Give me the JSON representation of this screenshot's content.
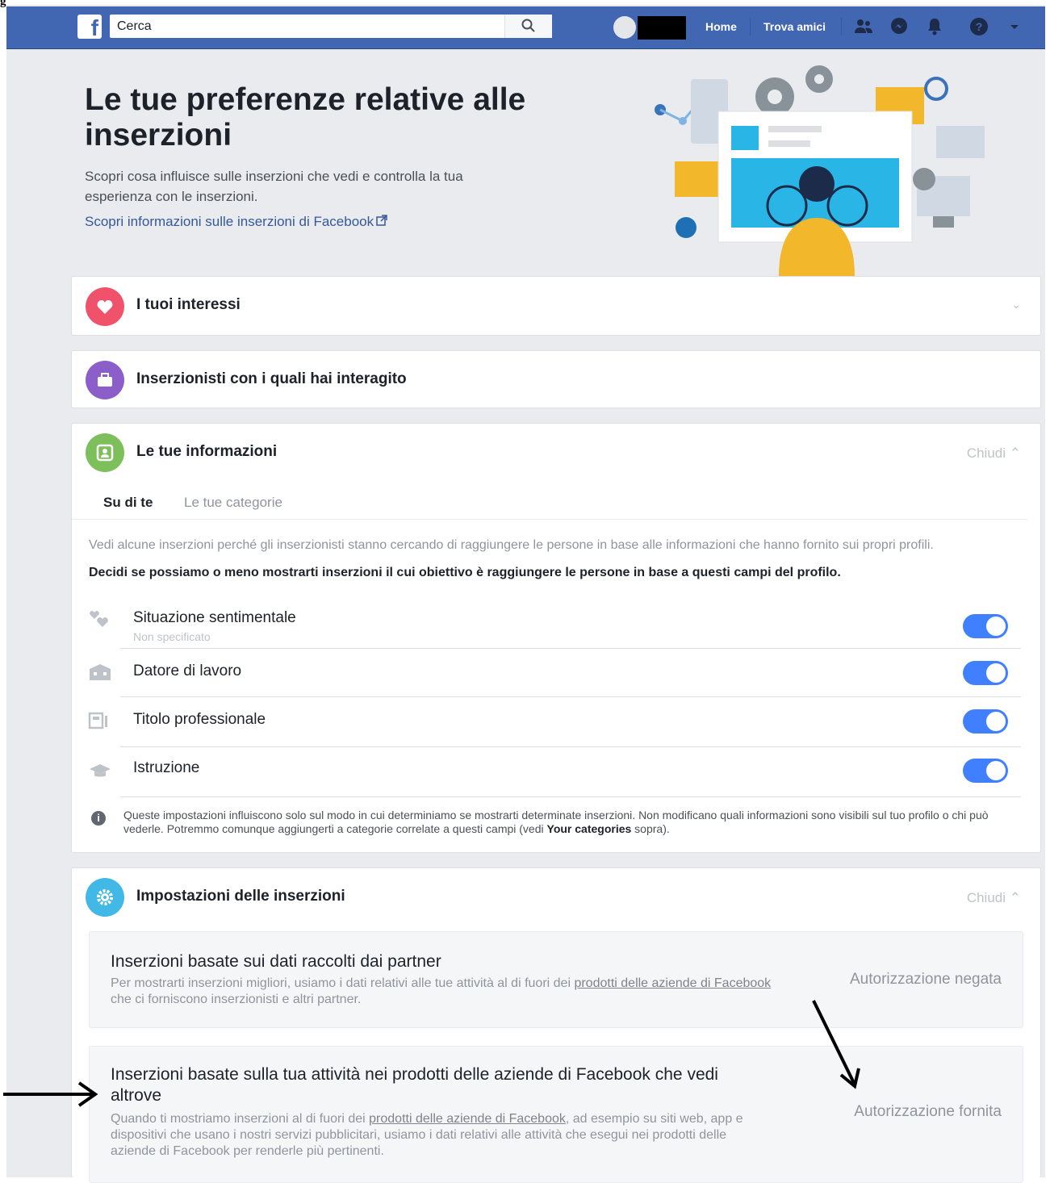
{
  "corner_mark": "g",
  "topbar": {
    "search_placeholder": "Cerca",
    "nav": {
      "home": "Home",
      "find_friends": "Trova amici"
    }
  },
  "hero": {
    "title": "Le tue preferenze relative alle inserzioni",
    "description": "Scopri cosa influisce sulle inserzioni che vedi e controlla la tua esperienza con le inserzioni.",
    "link": "Scopri informazioni sulle inserzioni di Facebook"
  },
  "sections": {
    "interests": {
      "title": "I tuoi interessi"
    },
    "advertisers": {
      "title": "Inserzionisti con i quali hai interagito"
    },
    "your_info": {
      "title": "Le tue informazioni",
      "close_label": "Chiudi",
      "tabs": {
        "about_you": "Su di te",
        "categories": "Le tue categorie"
      },
      "info_text": "Vedi alcune inserzioni perché gli inserzionisti stanno cercando di raggiungere le persone in base alle informazioni che hanno fornito sui propri profili.",
      "decide_text": "Decidi se possiamo o meno mostrarti inserzioni il cui obiettivo è raggiungere le persone in base a questi campi del profilo.",
      "rows": [
        {
          "label": "Situazione sentimentale",
          "sub": "Non specificato",
          "enabled": true
        },
        {
          "label": "Datore di lavoro",
          "enabled": true
        },
        {
          "label": "Titolo professionale",
          "enabled": true
        },
        {
          "label": "Istruzione",
          "enabled": true
        }
      ],
      "note_part1": "Queste impostazioni influiscono solo sul modo in cui determiniamo se mostrarti determinate inserzioni. Non modificano quali informazioni sono visibili sul tuo profilo o chi può vederle. Potremmo comunque aggiungerti a categorie correlate a questi campi (vedi ",
      "note_bold": "Your categories",
      "note_part2": " sopra)."
    },
    "ad_settings": {
      "title": "Impostazioni delle inserzioni",
      "close_label": "Chiudi",
      "items": [
        {
          "title": "Inserzioni basate sui dati raccolti dai partner",
          "desc_part1": "Per mostrarti inserzioni migliori, usiamo i dati relativi alle tue attività al di fuori dei ",
          "desc_link": "prodotti delle aziende di Facebook",
          "desc_part2": " che ci forniscono inserzionisti e altri partner.",
          "status": "Autorizzazione negata"
        },
        {
          "title": "Inserzioni basate sulla tua attività nei prodotti delle aziende di Facebook che vedi altrove",
          "desc_part1": "Quando ti mostriamo inserzioni al di fuori dei ",
          "desc_link": "prodotti delle aziende di Facebook",
          "desc_part2": ", ad esempio su siti web, app e dispositivi che usano i nostri servizi pubblicitari, usiamo i dati relativi alle attività che esegui nei prodotti delle aziende di Facebook per renderle più pertinenti.",
          "status": "Autorizzazione fornita"
        }
      ]
    }
  },
  "colors": {
    "brand_blue": "#4267b2",
    "toggle_on": "#4080ff",
    "interests_icon": "#f0526b",
    "advertisers_icon": "#8c5ec9",
    "your_info_icon": "#7cbf5b",
    "ad_settings_icon": "#42b8e6"
  }
}
